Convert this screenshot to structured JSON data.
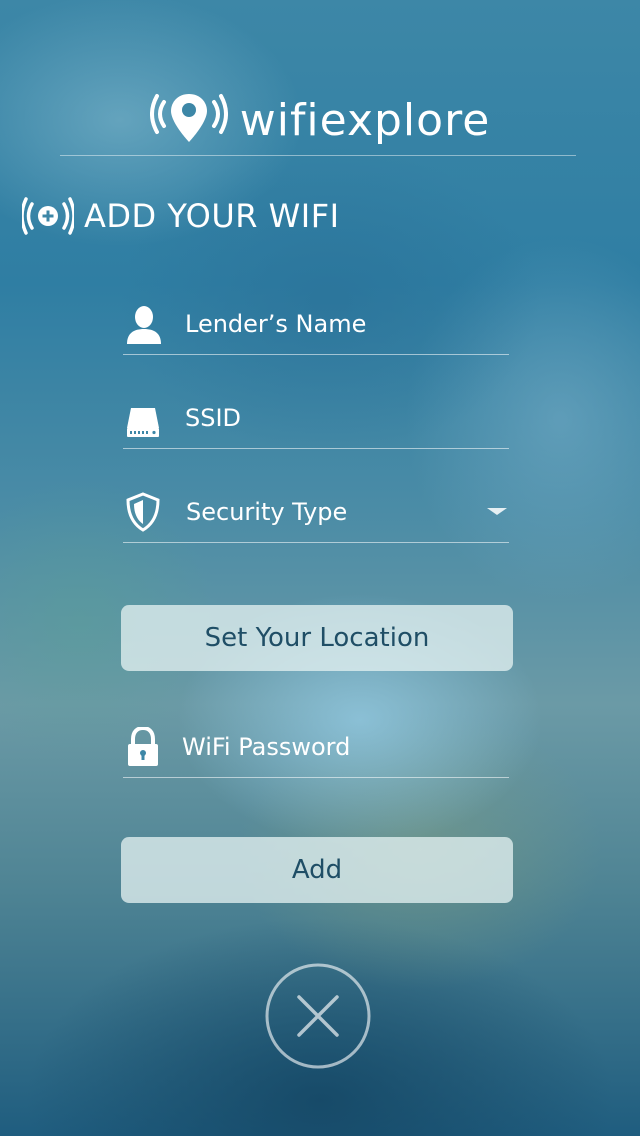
{
  "header": {
    "app_name": "wifiexplore",
    "logo_icon": "wifi-pin-icon"
  },
  "section": {
    "title": "ADD YOUR WIFI",
    "icon": "add-wifi-icon"
  },
  "form": {
    "lender_name": {
      "placeholder": "Lender’s Name",
      "value": "",
      "icon": "person-icon"
    },
    "ssid": {
      "placeholder": "SSID",
      "value": "",
      "icon": "router-icon"
    },
    "security_type": {
      "label": "Security Type",
      "icon": "shield-icon"
    },
    "set_location_label": "Set Your Location",
    "wifi_password": {
      "placeholder": "WiFi Password",
      "value": "",
      "icon": "lock-icon"
    },
    "add_label": "Add"
  },
  "close": {
    "icon": "close-icon"
  },
  "colors": {
    "button_text": "#1f4e66",
    "button_bg": "#dff0f0"
  }
}
